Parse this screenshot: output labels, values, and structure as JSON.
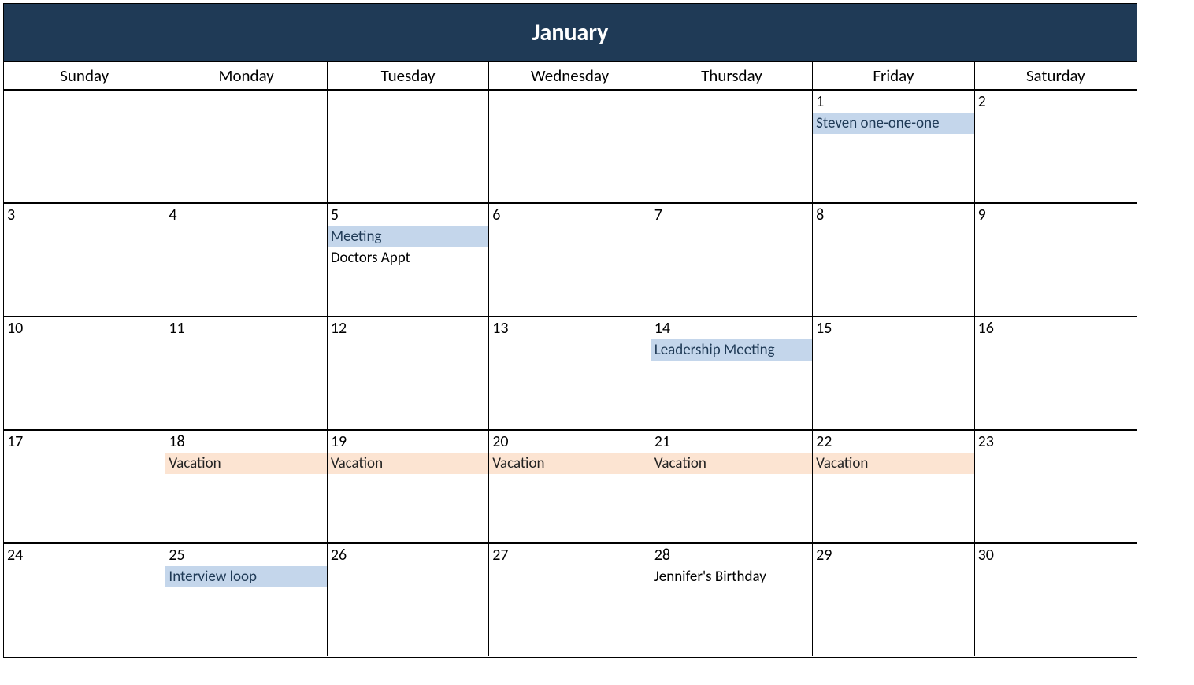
{
  "month": "January",
  "dayNames": [
    "Sunday",
    "Monday",
    "Tuesday",
    "Wednesday",
    "Thursday",
    "Friday",
    "Saturday"
  ],
  "weeks": [
    [
      {
        "num": "",
        "events": []
      },
      {
        "num": "",
        "events": []
      },
      {
        "num": "",
        "events": []
      },
      {
        "num": "",
        "events": []
      },
      {
        "num": "",
        "events": []
      },
      {
        "num": "1",
        "events": [
          {
            "label": "Steven one-one-one",
            "style": "blue"
          }
        ]
      },
      {
        "num": "2",
        "events": []
      }
    ],
    [
      {
        "num": "3",
        "events": []
      },
      {
        "num": "4",
        "events": []
      },
      {
        "num": "5",
        "events": [
          {
            "label": "Meeting",
            "style": "blue"
          },
          {
            "label": "Doctors Appt",
            "style": "plain"
          }
        ]
      },
      {
        "num": "6",
        "events": []
      },
      {
        "num": "7",
        "events": []
      },
      {
        "num": "8",
        "events": []
      },
      {
        "num": "9",
        "events": []
      }
    ],
    [
      {
        "num": "10",
        "events": []
      },
      {
        "num": "11",
        "events": []
      },
      {
        "num": "12",
        "events": []
      },
      {
        "num": "13",
        "events": []
      },
      {
        "num": "14",
        "events": [
          {
            "label": "Leadership Meeting",
            "style": "blue"
          }
        ]
      },
      {
        "num": "15",
        "events": []
      },
      {
        "num": "16",
        "events": []
      }
    ],
    [
      {
        "num": "17",
        "events": []
      },
      {
        "num": "18",
        "events": [
          {
            "label": "Vacation",
            "style": "peach"
          }
        ]
      },
      {
        "num": "19",
        "events": [
          {
            "label": "Vacation",
            "style": "peach"
          }
        ]
      },
      {
        "num": "20",
        "events": [
          {
            "label": "Vacation",
            "style": "peach"
          }
        ]
      },
      {
        "num": "21",
        "events": [
          {
            "label": "Vacation",
            "style": "peach"
          }
        ]
      },
      {
        "num": "22",
        "events": [
          {
            "label": "Vacation",
            "style": "peach"
          }
        ]
      },
      {
        "num": "23",
        "events": []
      }
    ],
    [
      {
        "num": "24",
        "events": []
      },
      {
        "num": "25",
        "events": [
          {
            "label": "Interview loop",
            "style": "blue"
          }
        ]
      },
      {
        "num": "26",
        "events": []
      },
      {
        "num": "27",
        "events": []
      },
      {
        "num": "28",
        "events": [
          {
            "label": "Jennifer's Birthday",
            "style": "plain"
          }
        ]
      },
      {
        "num": "29",
        "events": []
      },
      {
        "num": "30",
        "events": []
      }
    ]
  ]
}
